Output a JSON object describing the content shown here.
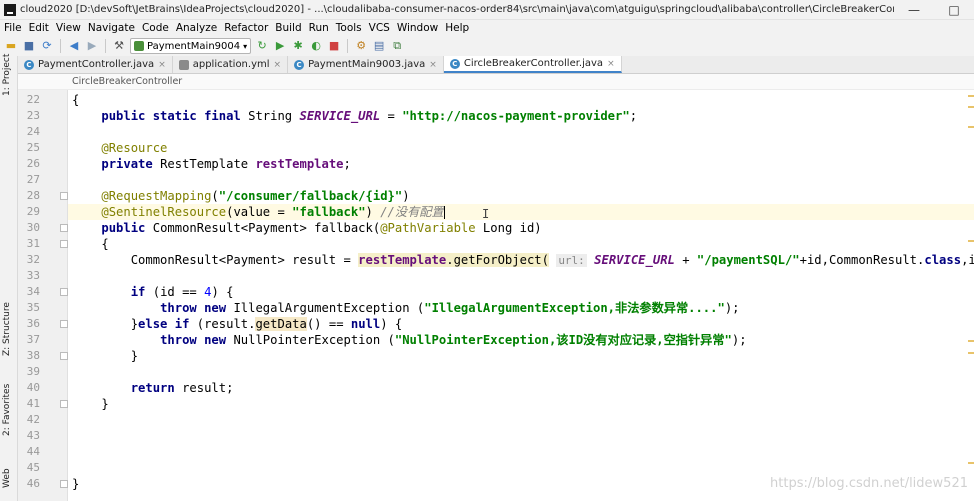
{
  "window": {
    "title": "cloud2020 [D:\\devSoft\\JetBrains\\IdeaProjects\\cloud2020] - ...\\cloudalibaba-consumer-nacos-order84\\src\\main\\java\\com\\atguigu\\springcloud\\alibaba\\controller\\CircleBreakerController.java [cloudalibaba-c...",
    "minimize": "—",
    "maximize": "□"
  },
  "menu": [
    "File",
    "Edit",
    "View",
    "Navigate",
    "Code",
    "Analyze",
    "Refactor",
    "Build",
    "Run",
    "Tools",
    "VCS",
    "Window",
    "Help"
  ],
  "toolbar": {
    "run_config": "PaymentMain9004",
    "icons": [
      "folder-open-icon",
      "save-icon",
      "sync-icon",
      "back-arrow-icon",
      "forward-arrow-icon",
      "build-hammer-icon",
      "run-config-selector",
      "rebuild-icon",
      "run-icon",
      "debug-icon",
      "coverage-icon",
      "stop-icon",
      "project-structure-icon",
      "sdk-icon",
      "settings-icon"
    ]
  },
  "left_strip": {
    "project": "1: Project",
    "structure": "Z: Structure",
    "favorites": "2: Favorites",
    "web": "Web"
  },
  "tabs": [
    {
      "label": "PaymentController.java",
      "icon": "C",
      "active": false
    },
    {
      "label": "application.yml",
      "icon": "yml",
      "active": false
    },
    {
      "label": "PaymentMain9003.java",
      "icon": "C",
      "active": false
    },
    {
      "label": "CircleBreakerController.java",
      "icon": "C",
      "active": true
    }
  ],
  "tab_close": "×",
  "breadcrumb": "CircleBreakerController",
  "editor": {
    "lines": [
      {
        "n": "22",
        "html": "{"
      },
      {
        "n": "23",
        "html": "    <span class=\"kw\">public static final</span> String <span class=\"const\">SERVICE_URL</span> = <span class=\"str\">\"http://nacos-payment-provider\"</span>;"
      },
      {
        "n": "24",
        "html": ""
      },
      {
        "n": "25",
        "html": "    <span class=\"ann\">@Resource</span>"
      },
      {
        "n": "26",
        "html": "    <span class=\"kw\">private</span> RestTemplate <span class=\"field\">restTemplate</span>;"
      },
      {
        "n": "27",
        "html": ""
      },
      {
        "n": "28",
        "html": "    <span class=\"ann\">@RequestMapping</span>(<span class=\"str\">\"/consumer/fallback/{id}\"</span>)"
      },
      {
        "n": "29",
        "html": "    <span class=\"ann\">@SentinelResource</span>(value = <span class=\"str\">\"fallback\"</span>) <span class=\"cmt\">//没有配置</span><span class=\"caret\"></span>"
      },
      {
        "n": "30",
        "html": "    <span class=\"kw\">public</span> CommonResult&lt;Payment&gt; fallback(<span class=\"ann\">@PathVariable</span> Long id)"
      },
      {
        "n": "31",
        "html": "    {"
      },
      {
        "n": "32",
        "html": "        CommonResult&lt;Payment&gt; result = <span class=\"method-hl\"><span class=\"field\">restTemplate</span>.getForObject(</span> <span class=\"hint\">url:</span> <span class=\"const\">SERVICE_URL</span> + <span class=\"str\">\"/paymentSQL/\"</span>+id,CommonResult.<span class=\"kw\">class</span>,id);"
      },
      {
        "n": "33",
        "html": ""
      },
      {
        "n": "34",
        "html": "        <span class=\"kw\">if</span> (id == <span class=\"num\">4</span>) {"
      },
      {
        "n": "35",
        "html": "            <span class=\"kw\">throw new</span> IllegalArgumentException (<span class=\"str\">\"IllegalArgumentException,非法参数异常....\"</span>);"
      },
      {
        "n": "36",
        "html": "        }<span class=\"kw\">else if</span> (result.<span class=\"hl\">getData</span>() == <span class=\"kw\">null</span>) {"
      },
      {
        "n": "37",
        "html": "            <span class=\"kw\">throw new</span> NullPointerException (<span class=\"str\">\"NullPointerException,该ID没有对应记录,空指针异常\"</span>);"
      },
      {
        "n": "38",
        "html": "        }"
      },
      {
        "n": "39",
        "html": ""
      },
      {
        "n": "40",
        "html": "        <span class=\"kw\">return</span> result;"
      },
      {
        "n": "41",
        "html": "    }"
      },
      {
        "n": "42",
        "html": ""
      },
      {
        "n": "43",
        "html": ""
      },
      {
        "n": "44",
        "html": ""
      },
      {
        "n": "45",
        "html": ""
      },
      {
        "n": "46",
        "html": "}"
      }
    ],
    "current_line": "29",
    "fold_lines": [
      "28",
      "30",
      "31",
      "34",
      "36",
      "38",
      "41",
      "46"
    ]
  },
  "watermark": "https://blog.csdn.net/lidew521"
}
